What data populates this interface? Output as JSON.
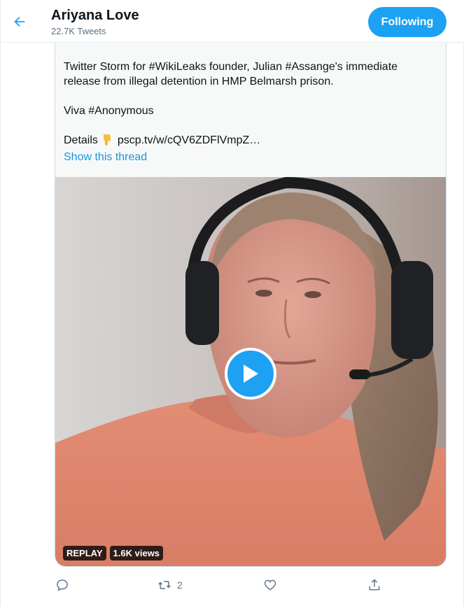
{
  "header": {
    "name": "Ariyana Love",
    "tweet_count": "22.7K Tweets",
    "follow_label": "Following",
    "back_icon": "arrow-left-icon"
  },
  "tweet": {
    "line1": "Twitter Storm for #WikiLeaks founder, Julian #Assange's immediate",
    "line2": "release from illegal detention in HMP Belmarsh prison.",
    "line3": "Viva #Anonymous",
    "details_prefix": "Details",
    "details_link": "pscp.tv/w/cQV6ZDFlVmpZ…",
    "show_thread": "Show this thread"
  },
  "media": {
    "replay_label": "REPLAY",
    "views_label": "1.6K views"
  },
  "actions": {
    "retweet_count": "2"
  },
  "colors": {
    "accent": "#1da1f2",
    "link": "#1b95e0",
    "muted": "#5b7083"
  }
}
